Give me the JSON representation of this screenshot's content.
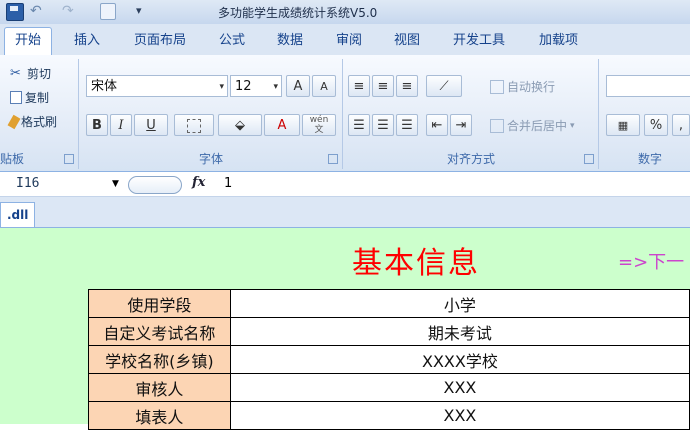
{
  "window": {
    "title": "多功能学生成绩统计系统V5.0"
  },
  "quick_access": {
    "more": "▾"
  },
  "ribbon_tabs": [
    "开始",
    "插入",
    "页面布局",
    "公式",
    "数据",
    "审阅",
    "视图",
    "开发工具",
    "加载项"
  ],
  "clipboard": {
    "cut": "剪切",
    "copy": "复制",
    "format_painter": "格式刷",
    "label": "贴板"
  },
  "font": {
    "name": "宋体",
    "size": "12",
    "grow": "A",
    "shrink": "A",
    "bold": "B",
    "italic": "I",
    "underline": "U",
    "color_a": "A",
    "wen": "wén\n文",
    "label": "字体"
  },
  "alignment": {
    "wrap_text": "自动换行",
    "merge_center": "合并后居中",
    "label": "对齐方式"
  },
  "number": {
    "percent": "%",
    "comma": ",",
    "label": "数字"
  },
  "formula_bar": {
    "cell_ref": "I16",
    "fx": "fx",
    "value": "1"
  },
  "sheet_tab": ".dll",
  "sheet": {
    "title": "基本信息",
    "next_link": "=>下一",
    "rows": [
      {
        "label": "使用学段",
        "value": "小学"
      },
      {
        "label": "自定义考试名称",
        "value": "期未考试"
      },
      {
        "label": "学校名称(乡镇)",
        "value": "XXXX学校"
      },
      {
        "label": "审核人",
        "value": "XXX"
      },
      {
        "label": "填表人",
        "value": "XXX"
      }
    ]
  },
  "colors": {
    "title_red": "#ff0000",
    "label_fill": "#fcd5b4",
    "sheet_bg": "#ccffcc",
    "link": "#cc44cc"
  }
}
